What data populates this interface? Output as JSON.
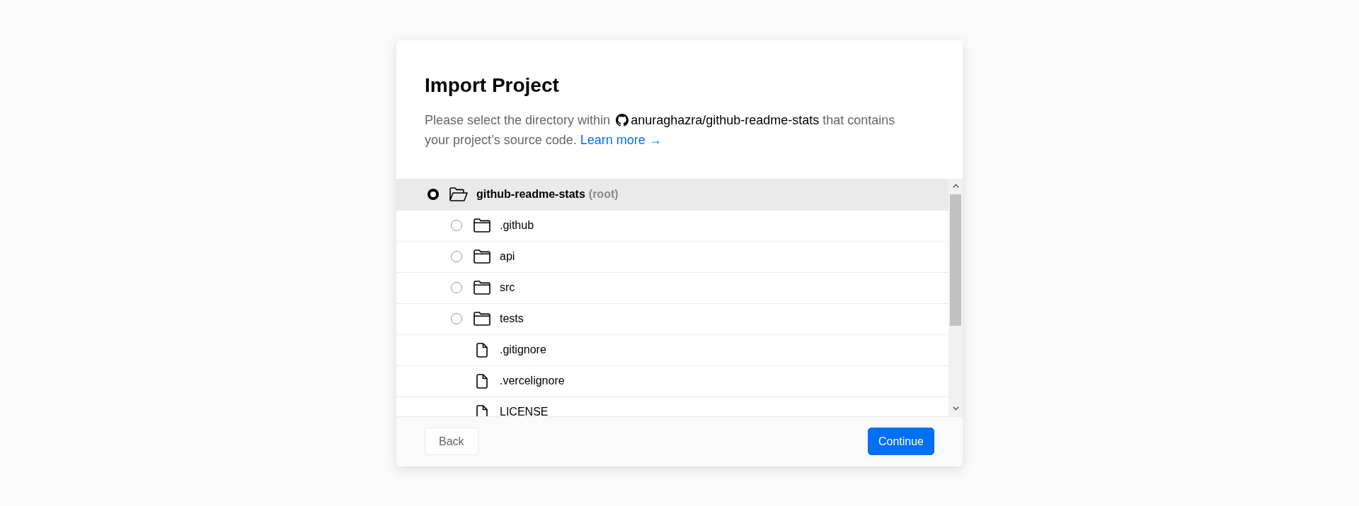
{
  "dialog": {
    "title": "Import Project",
    "description": {
      "lead": "Please select the directory within",
      "repo": "anuraghazra/github-readme-stats",
      "rest": "that contains your project’s source code.",
      "link": "Learn more →"
    }
  },
  "tree": {
    "items": [
      {
        "name": "github-readme-stats",
        "note": "(root)",
        "kind": "folder",
        "selected": true,
        "expanded": true,
        "children": [
          {
            "name": ".github",
            "kind": "folder",
            "selected": false,
            "expanded": false
          },
          {
            "name": "api",
            "kind": "folder",
            "selected": false,
            "expanded": false
          },
          {
            "name": "src",
            "kind": "folder",
            "selected": false,
            "expanded": false
          },
          {
            "name": "tests",
            "kind": "folder",
            "selected": false,
            "expanded": false
          },
          {
            "name": ".gitignore",
            "kind": "file"
          },
          {
            "name": ".vercelignore",
            "kind": "file"
          },
          {
            "name": "LICENSE",
            "kind": "file"
          }
        ]
      }
    ]
  },
  "footer": {
    "buttons": [
      {
        "label": "Back",
        "kind": "secondary"
      },
      {
        "label": "Continue",
        "kind": "primary"
      }
    ]
  }
}
